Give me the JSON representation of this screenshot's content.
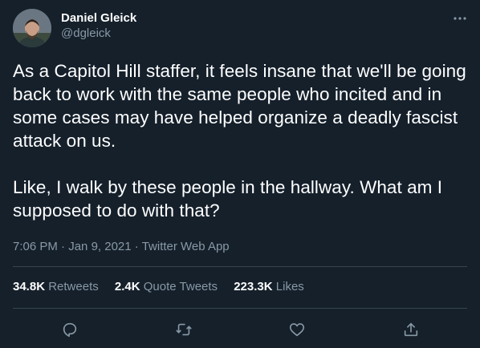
{
  "author": {
    "name": "Daniel Gleick",
    "handle": "@dgleick"
  },
  "tweet": {
    "paragraph_1": "As a Capitol Hill staffer, it feels insane that we'll be going back to work with the same people who incited and in some cases may have helped organize a deadly fascist attack on us.",
    "paragraph_2": "Like, I walk by these people in the hallway. What am I supposed to do with that?",
    "time": "7:06 PM",
    "date": "Jan 9, 2021",
    "source": "Twitter Web App",
    "separator": "·"
  },
  "stats": {
    "retweets_count": "34.8K",
    "retweets_label": "Retweets",
    "quotes_count": "2.4K",
    "quotes_label": "Quote Tweets",
    "likes_count": "223.3K",
    "likes_label": "Likes"
  },
  "icons": {
    "more": "more-horizontal-icon",
    "reply": "reply-icon",
    "retweet": "retweet-icon",
    "like": "heart-icon",
    "share": "share-icon"
  },
  "colors": {
    "background": "#15202b",
    "primary_text": "#ffffff",
    "secondary_text": "#8899a6",
    "divider": "#38444d"
  }
}
